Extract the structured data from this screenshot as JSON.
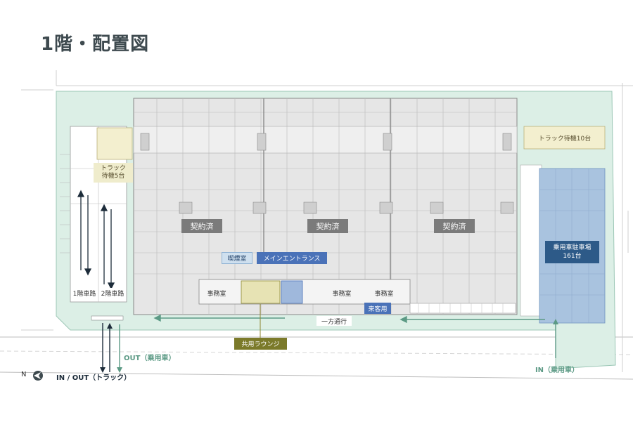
{
  "title": "1階・配置図",
  "rooms": {
    "contracted": "契約済",
    "smoking_room": "喫煙室",
    "main_entrance": "メインエントランス",
    "office": "事務室",
    "visitor": "来客用",
    "lounge": "共用ラウンジ",
    "truck_wait_5": "トラック\n待機5台",
    "truck_wait_10": "トラック待機10台",
    "car_parking_line1": "乗用車駐車場",
    "car_parking_line2": "161台"
  },
  "roads": {
    "ramp_1f": "1階車路",
    "ramp_2f": "2階車路",
    "one_way": "一方通行",
    "out_car": "OUT（乗用車）",
    "in_car": "IN（乗用車）",
    "inout_truck": "IN / OUT（トラック）"
  },
  "compass": {
    "icon": "north-arrow-icon",
    "letter": "N"
  },
  "colors": {
    "site_green": "#dcefe6",
    "building_gray": "#e6e6e6",
    "grid_line": "#b9b9b9",
    "parking_blue": "#a9c3df",
    "accent_blue": "#4a72b8",
    "arrow_green": "#5c9a85",
    "arrow_navy": "#1d2c3a"
  }
}
